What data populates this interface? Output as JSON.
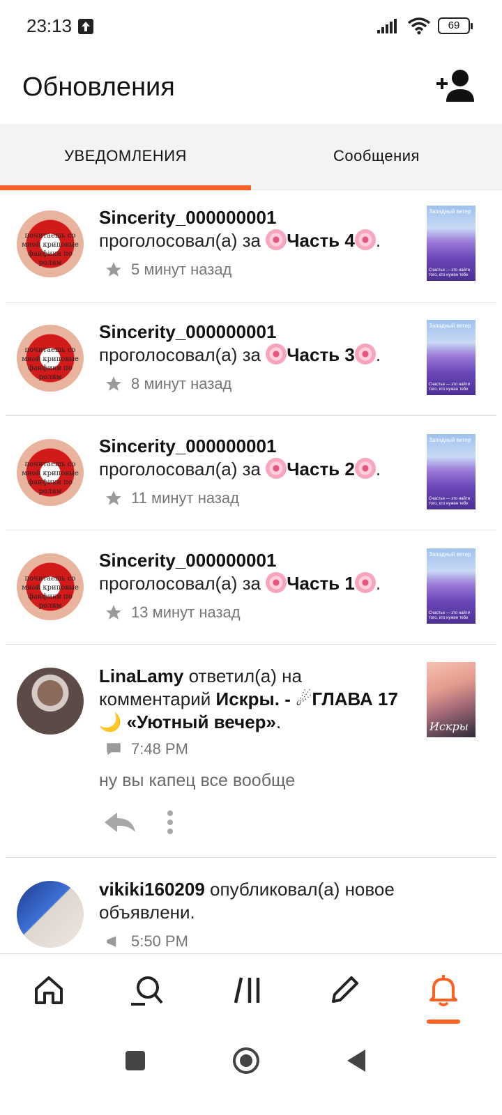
{
  "status_bar": {
    "time": "23:13",
    "battery": "69"
  },
  "header": {
    "title": "Обновления",
    "add_friend_icon": "add-user-icon"
  },
  "tabs": [
    {
      "label": "УВЕДОМЛЕНИЯ",
      "active": true
    },
    {
      "label": "Сообщения",
      "active": false
    }
  ],
  "colors": {
    "accent": "#ff6122",
    "text": "#121212",
    "muted": "#767676"
  },
  "feed": [
    {
      "user": "Sincerity_000000001",
      "action": "проголосовал(а) за",
      "target": "Часть 4",
      "time": "5 минут назад",
      "meta_icon": "star-icon",
      "cover_title": "Западный ветер",
      "cover_sub": "Счастье — это найти того, кто нужен тебе"
    },
    {
      "user": "Sincerity_000000001",
      "action": "проголосовал(а) за",
      "target": "Часть 3",
      "time": "8 минут назад",
      "meta_icon": "star-icon",
      "cover_title": "Западный ветер",
      "cover_sub": "Счастье — это найти того, кто нужен тебе"
    },
    {
      "user": "Sincerity_000000001",
      "action": "проголосовал(а) за",
      "target": "Часть 2",
      "time": "11 минут назад",
      "meta_icon": "star-icon",
      "cover_title": "Западный ветер",
      "cover_sub": "Счастье — это найти того, кто нужен тебе"
    },
    {
      "user": "Sincerity_000000001",
      "action": "проголосовал(а) за",
      "target": "Часть 1",
      "time": "13 минут назад",
      "meta_icon": "star-icon",
      "cover_title": "Западный ветер",
      "cover_sub": "Счастье — это найти того, кто нужен тебе"
    },
    {
      "user": "LinaLamy",
      "action": "ответил(а) на комментарий",
      "story": "Искры. -",
      "chapter": "ГЛАВА 17",
      "chapter_name": "«Уютный вечер»",
      "time": "7:48 PM",
      "meta_icon": "comment-icon",
      "comment": "ну вы капец все вообще",
      "cover_title": "Искры"
    },
    {
      "user": "vikiki160209",
      "action": "опубликовал(а) новое объявлени.",
      "time": "5:50 PM",
      "meta_icon": "megaphone-icon"
    }
  ],
  "avatar_text": "почитаешь со мной криповые фанфики по ролям",
  "bottom_nav": [
    "home-icon",
    "search-icon",
    "library-icon",
    "write-icon",
    "notifications-icon"
  ]
}
